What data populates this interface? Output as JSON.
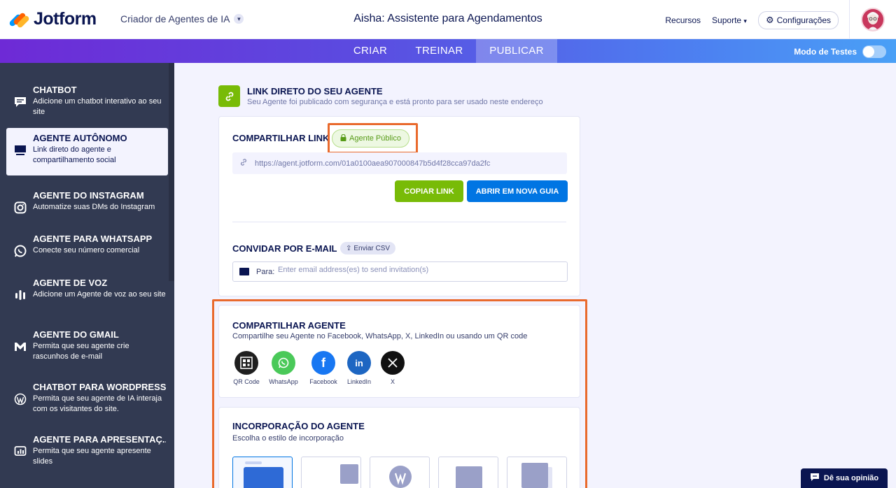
{
  "header": {
    "logo_text": "Jotform",
    "app_switcher": "Criador de Agentes de IA",
    "title": "Aisha: Assistente para Agendamentos",
    "resources": "Recursos",
    "support": "Suporte",
    "settings": "Configurações"
  },
  "tabs": [
    {
      "label": "CRIAR"
    },
    {
      "label": "TREINAR"
    },
    {
      "label": "PUBLICAR"
    }
  ],
  "test_mode": {
    "label": "Modo de Testes",
    "enabled": false
  },
  "sidebar": {
    "items": [
      {
        "title": "CHATBOT",
        "desc": "Adicione um chatbot interativo ao seu site",
        "icon": "chat-icon"
      },
      {
        "title": "AGENTE AUTÔNOMO",
        "desc": "Link direto do agente e compartilhamento social",
        "icon": "monitor-icon"
      },
      {
        "title": "AGENTE DO INSTAGRAM",
        "desc": "Automatize suas DMs do Instagram",
        "icon": "instagram-icon"
      },
      {
        "title": "AGENTE PARA WHATSAPP",
        "desc": "Conecte seu número comercial",
        "icon": "whatsapp-icon"
      },
      {
        "title": "AGENTE DE VOZ",
        "desc": "Adicione um Agente de voz ao seu site",
        "icon": "voice-icon"
      },
      {
        "title": "AGENTE DO GMAIL",
        "desc": "Permita que seu agente crie rascunhos de e-mail",
        "icon": "gmail-icon"
      },
      {
        "title": "CHATBOT PARA WORDPRESS",
        "desc": "Permita que seu agente de IA interaja com os visitantes do site.",
        "icon": "wordpress-icon"
      },
      {
        "title": "AGENTE PARA APRESENTAÇ...",
        "desc": "Permita que seu agente apresente slides",
        "icon": "presentation-icon"
      }
    ]
  },
  "direct_link": {
    "title": "LINK DIRETO DO SEU AGENTE",
    "subtitle": "Seu Agente foi publicado com segurança e está pronto para ser usado neste endereço"
  },
  "share_link": {
    "label": "COMPARTILHAR LINK",
    "badge": "Agente Público",
    "url": "https://agent.jotform.com/01a0100aea907000847b5d4f28cca97da2fc",
    "copy_button": "COPIAR LINK",
    "open_button": "ABRIR EM NOVA GUIA"
  },
  "invite": {
    "label": "CONVIDAR POR E-MAIL",
    "csv_button": "Enviar CSV",
    "to_label": "Para:",
    "placeholder": "Enter email address(es) to send invitation(s)"
  },
  "share_agent": {
    "title": "COMPARTILHAR AGENTE",
    "subtitle": "Compartilhe seu Agente no Facebook, WhatsApp, X, LinkedIn ou usando um QR code",
    "options": [
      {
        "label": "QR Code",
        "color": "#1f1f1f",
        "glyph": "▦"
      },
      {
        "label": "WhatsApp",
        "color": "#4ac959",
        "glyph": "✆"
      },
      {
        "label": "Facebook",
        "color": "#1877f2",
        "glyph": "f"
      },
      {
        "label": "LinkedIn",
        "color": "#1d66c2",
        "glyph": "in"
      },
      {
        "label": "X",
        "color": "#111111",
        "glyph": "𝕏"
      }
    ]
  },
  "embed": {
    "title": "INCORPORAÇÃO DO AGENTE",
    "subtitle": "Escolha o estilo de incorporação"
  },
  "feedback": {
    "label": "Dê sua opinião"
  },
  "colors": {
    "accent_green": "#78bb07",
    "accent_blue": "#0075e3",
    "highlight": "#e96a2d"
  }
}
